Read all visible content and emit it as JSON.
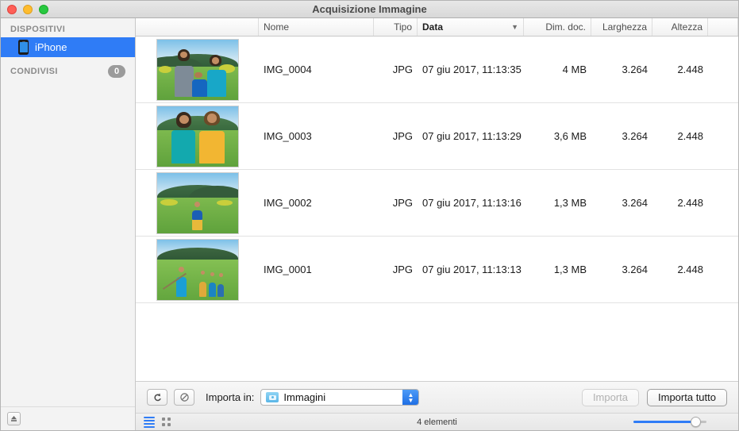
{
  "window": {
    "title": "Acquisizione Immagine",
    "traffic_lights": [
      "close",
      "minimize",
      "zoom"
    ]
  },
  "sidebar": {
    "sections": [
      {
        "header": "DISPOSITIVI",
        "items": [
          {
            "label": "iPhone",
            "icon": "iphone-icon",
            "selected": true
          }
        ]
      },
      {
        "header": "CONDIVISI",
        "badge": "0",
        "items": []
      }
    ],
    "footer_icon": "eject-icon"
  },
  "table": {
    "columns": [
      {
        "key": "thumb",
        "label": "",
        "align": "left",
        "sorted": false
      },
      {
        "key": "name",
        "label": "Nome",
        "align": "left",
        "sorted": false
      },
      {
        "key": "type",
        "label": "Tipo",
        "align": "right",
        "sorted": false
      },
      {
        "key": "date",
        "label": "Data",
        "align": "left",
        "sorted": true
      },
      {
        "key": "size",
        "label": "Dim. doc.",
        "align": "right",
        "sorted": false
      },
      {
        "key": "width",
        "label": "Larghezza",
        "align": "right",
        "sorted": false
      },
      {
        "key": "height",
        "label": "Altezza",
        "align": "right",
        "sorted": false
      }
    ],
    "sort_indicator": "chevron-down-icon",
    "rows": [
      {
        "name": "IMG_0004",
        "type": "JPG",
        "date": "07 giu 2017, 11:13:35",
        "size": "4 MB",
        "width": "3.264",
        "height": "2.448"
      },
      {
        "name": "IMG_0003",
        "type": "JPG",
        "date": "07 giu 2017, 11:13:29",
        "size": "3,6 MB",
        "width": "3.264",
        "height": "2.448"
      },
      {
        "name": "IMG_0002",
        "type": "JPG",
        "date": "07 giu 2017, 11:13:16",
        "size": "1,3 MB",
        "width": "3.264",
        "height": "2.448"
      },
      {
        "name": "IMG_0001",
        "type": "JPG",
        "date": "07 giu 2017, 11:13:13",
        "size": "1,3 MB",
        "width": "3.264",
        "height": "2.448"
      }
    ]
  },
  "toolbar": {
    "rotate_icon": "rotate-counterclockwise-icon",
    "delete_icon": "prohibited-icon",
    "import_to_label": "Importa in:",
    "destination": {
      "icon": "images-folder-icon",
      "value": "Immagini",
      "stepper_icon": "up-down-chevron-icon"
    },
    "import_button": {
      "label": "Importa",
      "enabled": false
    },
    "import_all_button": {
      "label": "Importa tutto",
      "enabled": true
    }
  },
  "statusbar": {
    "list_view_icon": "list-view-icon",
    "grid_view_icon": "grid-view-icon",
    "active_view": "list",
    "item_count": "4 elementi",
    "zoom_slider": {
      "value": 85,
      "min": 0,
      "max": 100
    }
  },
  "colors": {
    "accent": "#2f7cf6",
    "selection": "#2f7cf6",
    "sidebar_bg": "#f3f3f3",
    "badge_bg": "#9b9b9b"
  }
}
